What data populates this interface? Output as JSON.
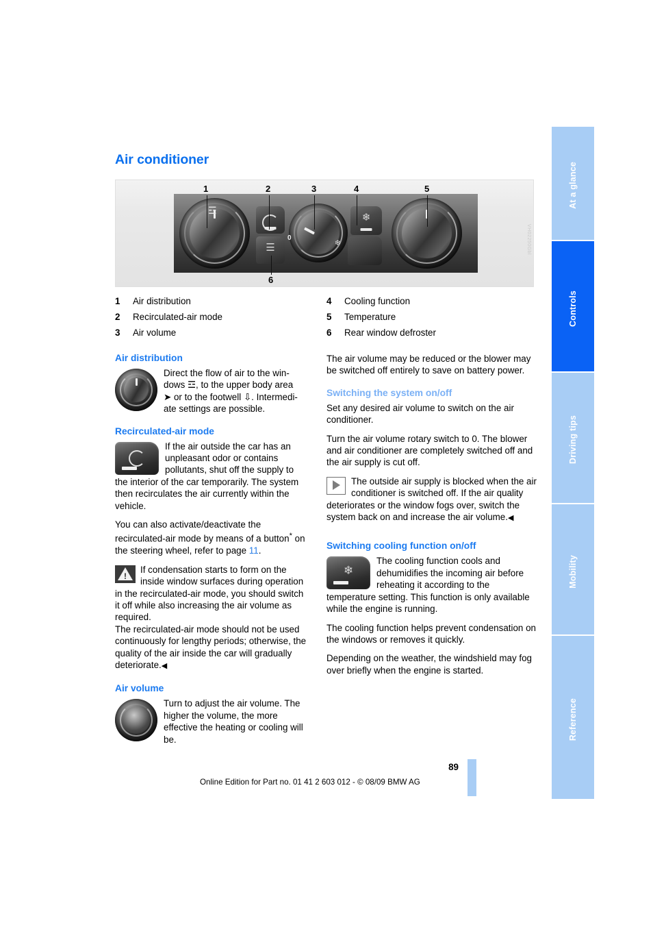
{
  "page_title": "Air conditioner",
  "tabs": [
    {
      "label": "At a glance",
      "active": false
    },
    {
      "label": "Controls",
      "active": true
    },
    {
      "label": "Driving tips",
      "active": false
    },
    {
      "label": "Mobility",
      "active": false
    },
    {
      "label": "Reference",
      "active": false
    }
  ],
  "figure": {
    "callouts": [
      "1",
      "2",
      "3",
      "4",
      "5",
      "6"
    ],
    "zero_mark": "0",
    "code": "VH02250Gbl"
  },
  "legend": {
    "left": [
      {
        "num": "1",
        "text": "Air distribution"
      },
      {
        "num": "2",
        "text": "Recirculated-air mode"
      },
      {
        "num": "3",
        "text": "Air volume"
      }
    ],
    "right": [
      {
        "num": "4",
        "text": "Cooling function"
      },
      {
        "num": "5",
        "text": "Temperature"
      },
      {
        "num": "6",
        "text": "Rear window defroster"
      }
    ]
  },
  "left_column": {
    "air_distribution": {
      "heading": "Air distribution",
      "body_1": "Direct the flow of air to the win-",
      "body_2": "dows ",
      "body_3": ", to the upper body area",
      "body_4": " or to the footwell ",
      "body_5": ". Intermedi-",
      "body_6": "ate settings are possible."
    },
    "recirculated_air": {
      "heading": "Recirculated-air mode",
      "para_1": "If the air outside the car has an unpleasant odor or contains pollutants, shut off the supply to the interior of the car temporarily. The system then recirculates the air currently within the vehicle.",
      "para_2_a": "You can also activate/deactivate the recirculated-air mode by means of a button",
      "para_2_star": "*",
      "para_2_b": " on the steering wheel, refer to page ",
      "para_2_page": "11",
      "para_2_c": ".",
      "warning_1": "If condensation starts to form on the inside window surfaces during operation in the recirculated-air mode, you should switch it off while also increasing the air volume as required.",
      "warning_2": "The recirculated-air mode should not be used continuously for lengthy periods; otherwise, the quality of the air inside the car will gradually deteriorate.",
      "end_mark": "◀"
    },
    "air_volume": {
      "heading": "Air volume",
      "para_1": "Turn to adjust the air volume. The higher the volume, the more effective the heating or cooling will be."
    }
  },
  "right_column": {
    "battery_note": "The air volume may be reduced or the blower may be switched off entirely to save on battery power.",
    "switching_system": {
      "heading": "Switching the system on/off",
      "para_1": "Set any desired air volume to switch on the air conditioner.",
      "para_2": "Turn the air volume rotary switch to 0. The blower and air conditioner are completely switched off and the air supply is cut off.",
      "note": "The outside air supply is blocked when the air conditioner is switched off. If the air quality deteriorates or the window fogs over, switch the system back on and increase the air volume.",
      "end_mark": "◀"
    },
    "switching_cooling": {
      "heading": "Switching cooling function on/off",
      "para_1": "The cooling function cools and dehumidifies the incoming air before reheating it according to the temperature setting. This function is only available while the engine is running.",
      "para_2": "The cooling function helps prevent condensation on the windows or removes it quickly.",
      "para_3": "Depending on the weather, the windshield may fog over briefly when the engine is started."
    }
  },
  "footer": {
    "page_number": "89",
    "copyright": "Online Edition for Part no. 01 41 2 603 012 - © 08/09 BMW AG"
  },
  "colors": {
    "heading_blue": "#0b70ee",
    "section_blue": "#1c7bf0",
    "pale_blue": "#7ab0f5",
    "tab_inactive": "#a8cdf5",
    "tab_active": "#0a62f5"
  },
  "icons": {
    "defrost_windshield": "☲",
    "rear_defroster": "☰",
    "snowflake": "❄",
    "upper_body": "➤",
    "footwell": "⇩"
  }
}
